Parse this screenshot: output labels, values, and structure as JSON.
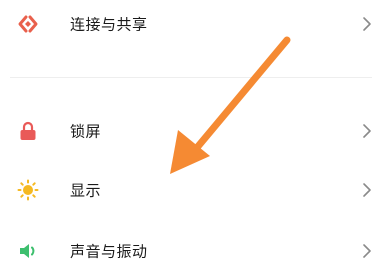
{
  "settings": {
    "items": [
      {
        "label": "连接与共享",
        "icon": "connection-share-icon",
        "color": "#e9604c"
      },
      {
        "label": "锁屏",
        "icon": "lock-icon",
        "color": "#e95a58"
      },
      {
        "label": "显示",
        "icon": "sun-icon",
        "color": "#f5b922"
      },
      {
        "label": "声音与振动",
        "icon": "speaker-icon",
        "color": "#3dbf6e"
      }
    ]
  },
  "colors": {
    "annotation_arrow": "#f58a33",
    "chevron": "#8a8a8a",
    "divider": "#eeeeee"
  }
}
